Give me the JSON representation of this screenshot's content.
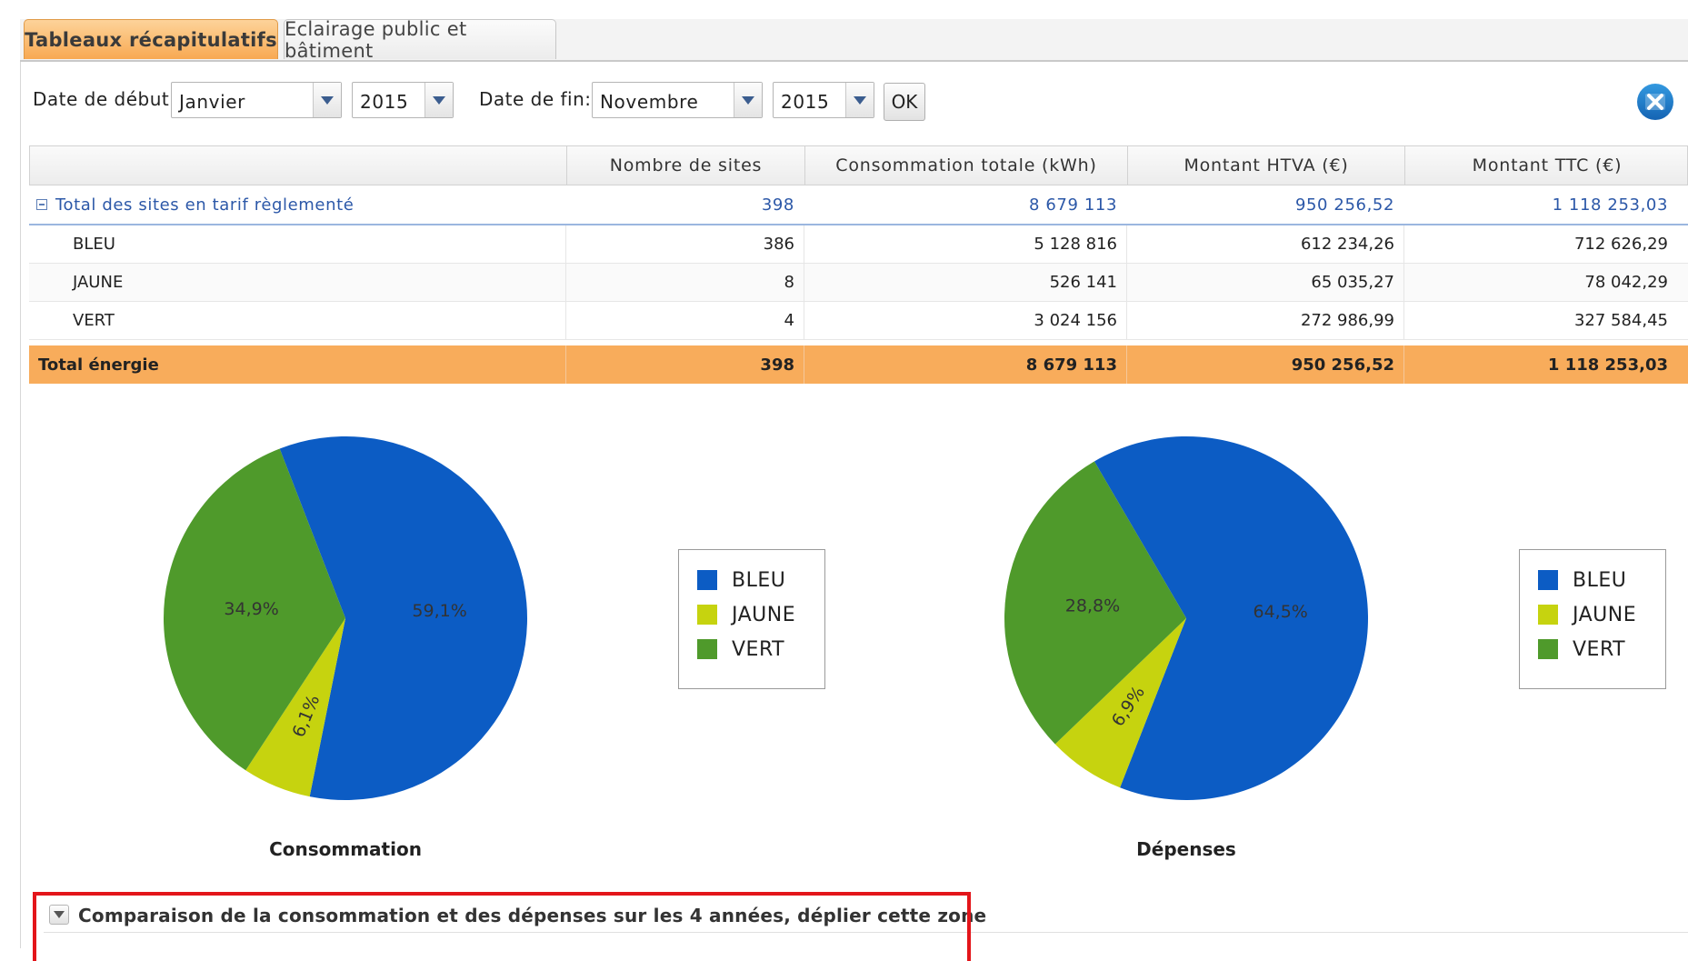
{
  "tabs": [
    {
      "label": "Tableaux récapitulatifs",
      "active": true
    },
    {
      "label": "Eclairage public et bâtiment",
      "active": false
    }
  ],
  "filters": {
    "start_label": "Date de début:",
    "start_month": "Janvier",
    "start_year": "2015",
    "end_label": "Date de fin:",
    "end_month": "Novembre",
    "end_year": "2015",
    "ok_label": "OK"
  },
  "export_icon": "excel-export-icon",
  "table": {
    "headers": [
      "",
      "Nombre de sites",
      "Consommation totale (kWh)",
      "Montant HTVA (€)",
      "Montant TTC (€)"
    ],
    "group": {
      "label": "Total des sites en tarif règlementé",
      "cells": [
        "398",
        "8 679 113",
        "950 256,52",
        "1 118 253,03"
      ]
    },
    "rows": [
      {
        "label": "BLEU",
        "cells": [
          "386",
          "5 128 816",
          "612 234,26",
          "712 626,29"
        ]
      },
      {
        "label": "JAUNE",
        "cells": [
          "8",
          "526 141",
          "65 035,27",
          "78 042,29"
        ]
      },
      {
        "label": "VERT",
        "cells": [
          "4",
          "3 024 156",
          "272 986,99",
          "327 584,45"
        ]
      }
    ],
    "total": {
      "label": "Total énergie",
      "cells": [
        "398",
        "8 679 113",
        "950 256,52",
        "1 118 253,03"
      ]
    }
  },
  "colors": {
    "BLEU": "#0c5cc4",
    "JAUNE": "#c6d30f",
    "VERT": "#4f9a2b",
    "accent": "#f8ac5b"
  },
  "chart_data": [
    {
      "type": "pie",
      "title": "Consommation",
      "categories": [
        "BLEU",
        "JAUNE",
        "VERT"
      ],
      "values": [
        59.1,
        6.1,
        34.9
      ],
      "labels": [
        "59,1%",
        "6,1%",
        "34,9%"
      ],
      "legend": "right"
    },
    {
      "type": "pie",
      "title": "Dépenses",
      "categories": [
        "BLEU",
        "JAUNE",
        "VERT"
      ],
      "values": [
        64.5,
        6.9,
        28.8
      ],
      "labels": [
        "64,5%",
        "6,9%",
        "28,8%"
      ],
      "legend": "right"
    }
  ],
  "collapse": {
    "label": "Comparaison de la consommation et des dépenses sur les 4 années, déplier cette zone"
  }
}
